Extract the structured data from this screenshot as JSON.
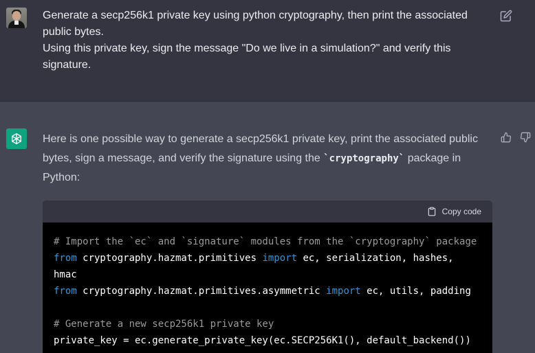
{
  "user_message": {
    "lines": [
      "Generate a secp256k1 private key using python cryptography, then print the associated",
      "public bytes.",
      "Using this private key, sign the message \"Do we live in a simulation?\" and verify this",
      "signature."
    ],
    "edit_icon": "edit-icon"
  },
  "assistant_message": {
    "line1": "Here is one possible way to generate a secp256k1 private key, print the associated public",
    "line2_before": "bytes, sign a message, and verify the signature using the ",
    "line2_code": "`cryptography`",
    "line2_after": " package in",
    "line3": "Python:",
    "thumbs_up_icon": "thumbs-up-icon",
    "thumbs_down_icon": "thumbs-down-icon"
  },
  "code_block": {
    "copy_label": "Copy code",
    "copy_icon": "clipboard-icon",
    "lines": {
      "l1": "# Import the `ec` and `signature` modules from the `cryptography` package",
      "l2_kw1": "from",
      "l2_mid": " cryptography.hazmat.primitives ",
      "l2_kw2": "import",
      "l2_end": " ec, serialization, hashes,",
      "l3": "hmac",
      "l4_kw1": "from",
      "l4_mid": " cryptography.hazmat.primitives.asymmetric ",
      "l4_kw2": "import",
      "l4_end": " ec, utils, padding",
      "l5": "",
      "l6": "# Generate a new secp256k1 private key",
      "l7": "private_key = ec.generate_private_key(ec.SECP256K1(), default_backend())"
    }
  },
  "colors": {
    "user_bg": "#343541",
    "assistant_bg": "#444654",
    "brand_green": "#10a37f",
    "keyword_blue": "#2e95d3"
  }
}
